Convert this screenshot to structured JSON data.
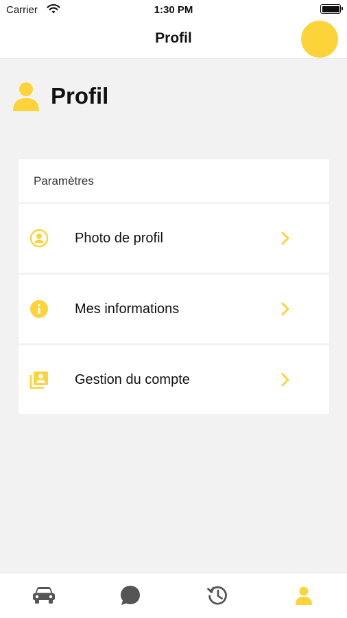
{
  "status_bar": {
    "carrier": "Carrier",
    "time": "1:30 PM"
  },
  "nav": {
    "title": "Profil"
  },
  "page": {
    "title": "Profil"
  },
  "settings": {
    "header": "Paramètres",
    "items": [
      {
        "label": "Photo de profil",
        "icon": "user-circle-icon"
      },
      {
        "label": "Mes informations",
        "icon": "info-icon"
      },
      {
        "label": "Gestion du compte",
        "icon": "account-management-icon"
      }
    ]
  },
  "tabs": [
    {
      "name": "car",
      "icon": "car-icon",
      "active": false
    },
    {
      "name": "messages",
      "icon": "chat-bubble-icon",
      "active": false
    },
    {
      "name": "history",
      "icon": "history-icon",
      "active": false
    },
    {
      "name": "profile",
      "icon": "person-icon",
      "active": true
    }
  ],
  "colors": {
    "accent": "#fdd33a",
    "inactive_tab": "#555555",
    "background": "#f2f2f2"
  }
}
